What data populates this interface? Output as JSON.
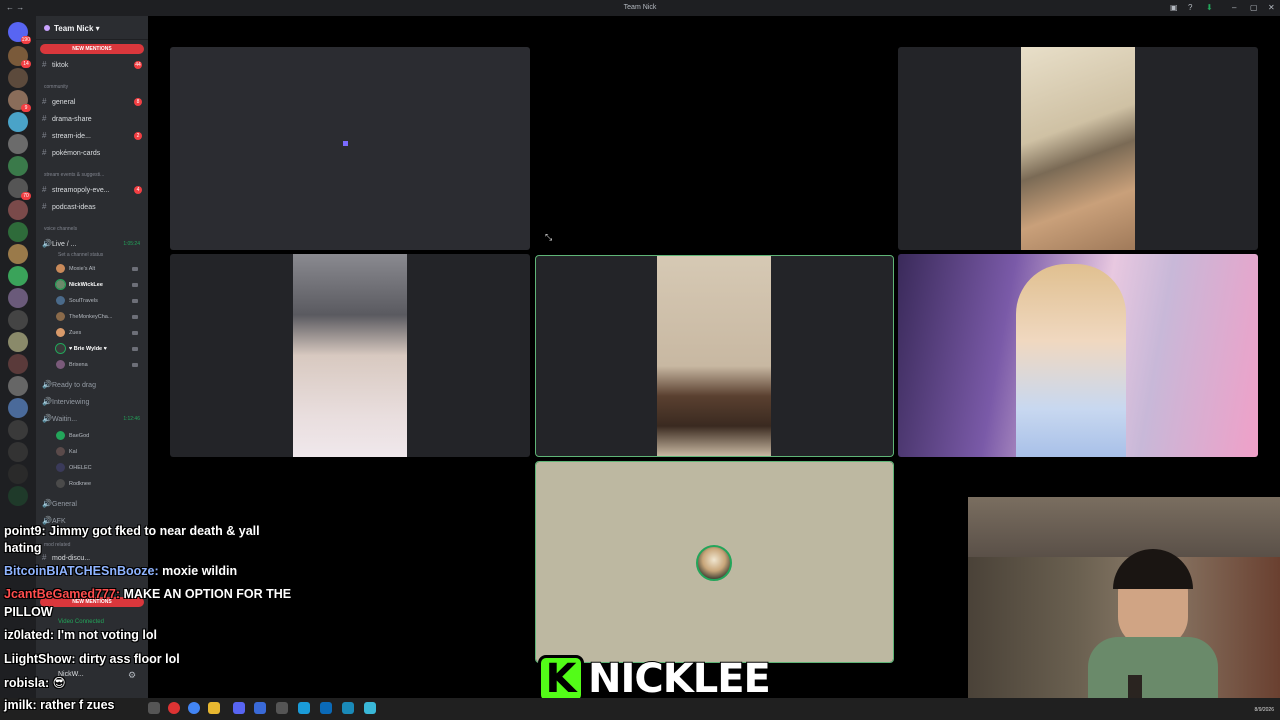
{
  "window": {
    "title": "Team Nick",
    "date": "8/9/2026"
  },
  "server": {
    "name": "Team Nick",
    "mention_banner": "NEW MENTIONS",
    "mention_banner_bottom": "NEW MENTIONS"
  },
  "channels": [
    {
      "name": "tiktok",
      "count": "44"
    },
    {
      "name": "general",
      "count": "8"
    },
    {
      "name": "drama-share",
      "count": ""
    },
    {
      "name": "stream-ide...",
      "count": "2"
    },
    {
      "name": "pokémon-cards",
      "count": ""
    },
    {
      "name": "streamopoly-eve...",
      "count": "4"
    },
    {
      "name": "podcast-ideas",
      "count": ""
    }
  ],
  "categories": {
    "community": "community",
    "stream_events": "stream events & suggesti...",
    "voice": "Voice Channels",
    "mod": "mod related"
  },
  "voice": {
    "live_channel": "Live / ...",
    "live_time": "1:05:24",
    "status_hint": "Set a channel status",
    "live_users": [
      "Moxie's Alt",
      "NickWickLee",
      "SoulTravels",
      "TheMonkeyCha...",
      "Zues",
      "♥ Brie Wylde ♥",
      "Brixena"
    ],
    "ready": "Ready to drag",
    "interviewing": "Interviewing",
    "waiting": "Waitin...",
    "waiting_time": "1:12:46",
    "waiting_users": [
      "BaeGod",
      "Kal",
      "OHELEC",
      "Rodknee"
    ],
    "general": "General",
    "afk": "AFK",
    "mod_channel": "mod-discu...",
    "video_connected": "Video Connected",
    "self_name": "NickW..."
  },
  "chat": [
    {
      "user": "point9:",
      "text": "Jimmy got fked to near death & yall",
      "user_color": "#ffffff"
    },
    {
      "user": "",
      "text": "hating",
      "user_color": "#ffffff"
    },
    {
      "user": "BitcoinBIATCHESnBooze:",
      "text": "moxie wildin",
      "user_color": "#8fb4ff"
    },
    {
      "user": "JcantBeGamed777:",
      "text": "MAKE AN OPTION FOR THE",
      "user_color": "#ff4d4d"
    },
    {
      "user": "",
      "text": "PILLOW",
      "user_color": "#ffffff"
    },
    {
      "user": "iz0lated:",
      "text": "I'm not voting lol",
      "user_color": "#ffffff"
    },
    {
      "user": "LiightShow:",
      "text": "dirty ass floor lol",
      "user_color": "#ffffff"
    },
    {
      "user": "robisla:",
      "text": "😎",
      "user_color": "#ffffff"
    },
    {
      "user": "jmilk:",
      "text": "rather f zues",
      "user_color": "#ffffff"
    }
  ],
  "brand": {
    "logo_letter": "K",
    "name": "NICKLEE"
  },
  "colors": {
    "speaking": "#5fb577",
    "kick_green": "#53fc18",
    "mention_red": "#da373c"
  }
}
